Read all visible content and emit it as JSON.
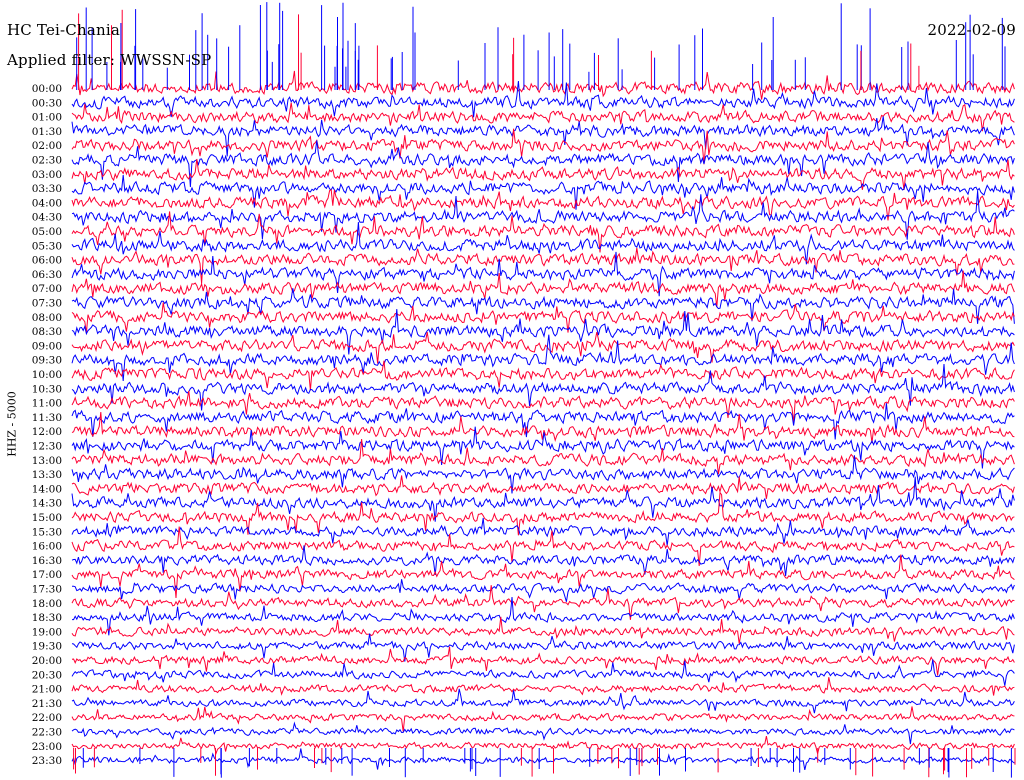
{
  "header": {
    "station": "HC Tei-Chania",
    "filter": "Applied filter: WWSSN-SP",
    "date": "2022-02-09"
  },
  "chart_data": {
    "type": "line",
    "title": "HC Tei-Chania",
    "subtitle": "Applied filter: WWSSN-SP",
    "date": "2022-02-09",
    "channel_label": "HHZ - 5000",
    "row_labels": [
      "00:00",
      "00:30",
      "01:00",
      "01:30",
      "02:00",
      "02:30",
      "03:00",
      "03:30",
      "04:00",
      "04:30",
      "05:00",
      "05:30",
      "06:00",
      "06:30",
      "07:00",
      "07:30",
      "08:00",
      "08:30",
      "09:00",
      "09:30",
      "10:00",
      "10:30",
      "11:00",
      "11:30",
      "12:00",
      "12:30",
      "13:00",
      "13:30",
      "14:00",
      "14:30",
      "15:00",
      "15:30",
      "16:00",
      "16:30",
      "17:00",
      "17:30",
      "18:00",
      "18:30",
      "19:00",
      "19:30",
      "20:00",
      "20:30",
      "21:00",
      "21:30",
      "22:00",
      "22:30",
      "23:00",
      "23:30"
    ],
    "trace_colors": [
      "#ff0033",
      "#0000ff"
    ],
    "grid": false,
    "legend": "none"
  }
}
